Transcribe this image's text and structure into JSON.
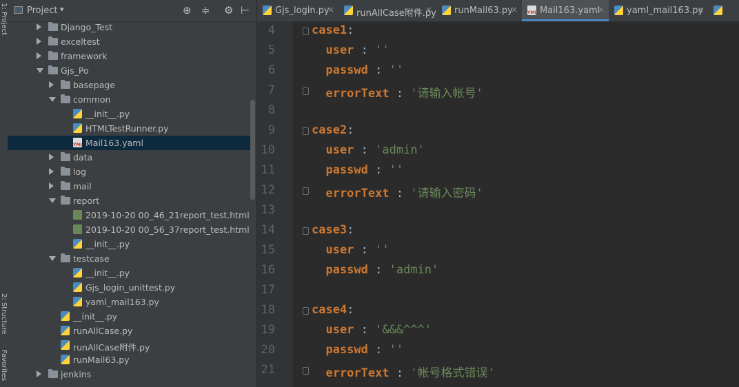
{
  "tool_strip": {
    "project_tab": "1: Project",
    "structure_tab": "2: Structure",
    "favorites_tab": "Favorites"
  },
  "project_panel": {
    "title": "Project",
    "header_icons": [
      "target-icon",
      "collapse-icon",
      "gear-icon",
      "hide-icon"
    ],
    "tree": [
      {
        "label": "Django_Test",
        "type": "folder",
        "expanded": false,
        "level": 0
      },
      {
        "label": "exceltest",
        "type": "folder",
        "expanded": false,
        "level": 0
      },
      {
        "label": "framework",
        "type": "folder",
        "expanded": false,
        "level": 0
      },
      {
        "label": "Gjs_Po",
        "type": "folder",
        "expanded": true,
        "level": 0
      },
      {
        "label": "basepage",
        "type": "folder",
        "expanded": false,
        "level": 1
      },
      {
        "label": "common",
        "type": "folder",
        "expanded": true,
        "level": 1
      },
      {
        "label": "__init__.py",
        "type": "py",
        "level": 2
      },
      {
        "label": "HTMLTestRunner.py",
        "type": "py",
        "level": 2
      },
      {
        "label": "Mail163.yaml",
        "type": "yaml",
        "level": 2,
        "selected": true
      },
      {
        "label": "data",
        "type": "folder",
        "expanded": false,
        "level": 1
      },
      {
        "label": "log",
        "type": "folder",
        "expanded": false,
        "level": 1
      },
      {
        "label": "mail",
        "type": "folder",
        "expanded": false,
        "level": 1
      },
      {
        "label": "report",
        "type": "folder",
        "expanded": true,
        "level": 1
      },
      {
        "label": "2019-10-20 00_46_21report_test.html",
        "type": "html",
        "level": 2
      },
      {
        "label": "2019-10-20 00_56_37report_test.html",
        "type": "html",
        "level": 2
      },
      {
        "label": "__init__.py",
        "type": "py",
        "level": 2
      },
      {
        "label": "testcase",
        "type": "folder",
        "expanded": true,
        "level": 1
      },
      {
        "label": "__init__.py",
        "type": "py",
        "level": 2
      },
      {
        "label": "Gjs_login_unittest.py",
        "type": "py",
        "level": 2
      },
      {
        "label": "yaml_mail163.py",
        "type": "py",
        "level": 2
      },
      {
        "label": "__init__.py",
        "type": "py",
        "level": 1
      },
      {
        "label": "runAllCase.py",
        "type": "py",
        "level": 1
      },
      {
        "label": "runAllCase附件.py",
        "type": "py",
        "level": 1
      },
      {
        "label": "runMail63.py",
        "type": "py",
        "level": 1
      },
      {
        "label": "jenkins",
        "type": "folder",
        "expanded": false,
        "level": 0
      }
    ]
  },
  "tabs": [
    {
      "label": "Gjs_login.py",
      "type": "py",
      "active": false
    },
    {
      "label": "runAllCase附件.py",
      "type": "py",
      "active": false
    },
    {
      "label": "runMail63.py",
      "type": "py",
      "active": false
    },
    {
      "label": "Mail163.yaml",
      "type": "yaml",
      "active": true
    },
    {
      "label": "yaml_mail163.py",
      "type": "py",
      "active": false
    }
  ],
  "close_glyph": "×",
  "editor": {
    "lines": [
      {
        "n": "4",
        "tokens": [
          {
            "t": "case1",
            "c": "k"
          },
          {
            "t": ":",
            "c": ""
          }
        ],
        "fold": true
      },
      {
        "n": "5",
        "tokens": [
          {
            "t": "  user",
            "c": "k"
          },
          {
            "t": " : ",
            "c": ""
          },
          {
            "t": "''",
            "c": "s"
          }
        ]
      },
      {
        "n": "6",
        "tokens": [
          {
            "t": "  passwd",
            "c": "k"
          },
          {
            "t": " : ",
            "c": ""
          },
          {
            "t": "''",
            "c": "s"
          }
        ]
      },
      {
        "n": "7",
        "tokens": [
          {
            "t": "  errorText",
            "c": "k"
          },
          {
            "t": " : ",
            "c": ""
          },
          {
            "t": "'请输入帐号'",
            "c": "s"
          }
        ],
        "fold": true
      },
      {
        "n": "8",
        "tokens": []
      },
      {
        "n": "9",
        "tokens": [
          {
            "t": "case2",
            "c": "k"
          },
          {
            "t": ":",
            "c": ""
          }
        ],
        "fold": true
      },
      {
        "n": "10",
        "tokens": [
          {
            "t": "  user",
            "c": "k"
          },
          {
            "t": " : ",
            "c": ""
          },
          {
            "t": "'admin'",
            "c": "s"
          }
        ]
      },
      {
        "n": "11",
        "tokens": [
          {
            "t": "  passwd",
            "c": "k"
          },
          {
            "t": " : ",
            "c": ""
          },
          {
            "t": "''",
            "c": "s"
          }
        ]
      },
      {
        "n": "12",
        "tokens": [
          {
            "t": "  errorText",
            "c": "k"
          },
          {
            "t": " : ",
            "c": ""
          },
          {
            "t": "'请输入密码'",
            "c": "s"
          }
        ],
        "fold": true
      },
      {
        "n": "13",
        "tokens": []
      },
      {
        "n": "14",
        "tokens": [
          {
            "t": "case3",
            "c": "k"
          },
          {
            "t": ":",
            "c": ""
          }
        ],
        "fold": true
      },
      {
        "n": "15",
        "tokens": [
          {
            "t": "  user",
            "c": "k"
          },
          {
            "t": " : ",
            "c": ""
          },
          {
            "t": "''",
            "c": "s"
          }
        ]
      },
      {
        "n": "16",
        "tokens": [
          {
            "t": "  passwd",
            "c": "k"
          },
          {
            "t": " : ",
            "c": ""
          },
          {
            "t": "'admin'",
            "c": "s"
          }
        ]
      },
      {
        "n": "17",
        "tokens": []
      },
      {
        "n": "18",
        "tokens": [
          {
            "t": "case4",
            "c": "k"
          },
          {
            "t": ":",
            "c": ""
          }
        ],
        "fold": true
      },
      {
        "n": "19",
        "tokens": [
          {
            "t": "  user",
            "c": "k"
          },
          {
            "t": " : ",
            "c": ""
          },
          {
            "t": "'&&&^^^'",
            "c": "s"
          }
        ]
      },
      {
        "n": "20",
        "tokens": [
          {
            "t": "  passwd",
            "c": "k"
          },
          {
            "t": " : ",
            "c": ""
          },
          {
            "t": "''",
            "c": "s"
          }
        ]
      },
      {
        "n": "21",
        "tokens": [
          {
            "t": "  errorText",
            "c": "k"
          },
          {
            "t": " : ",
            "c": ""
          },
          {
            "t": "'帐号格式错误'",
            "c": "s"
          }
        ],
        "fold": true
      }
    ]
  }
}
